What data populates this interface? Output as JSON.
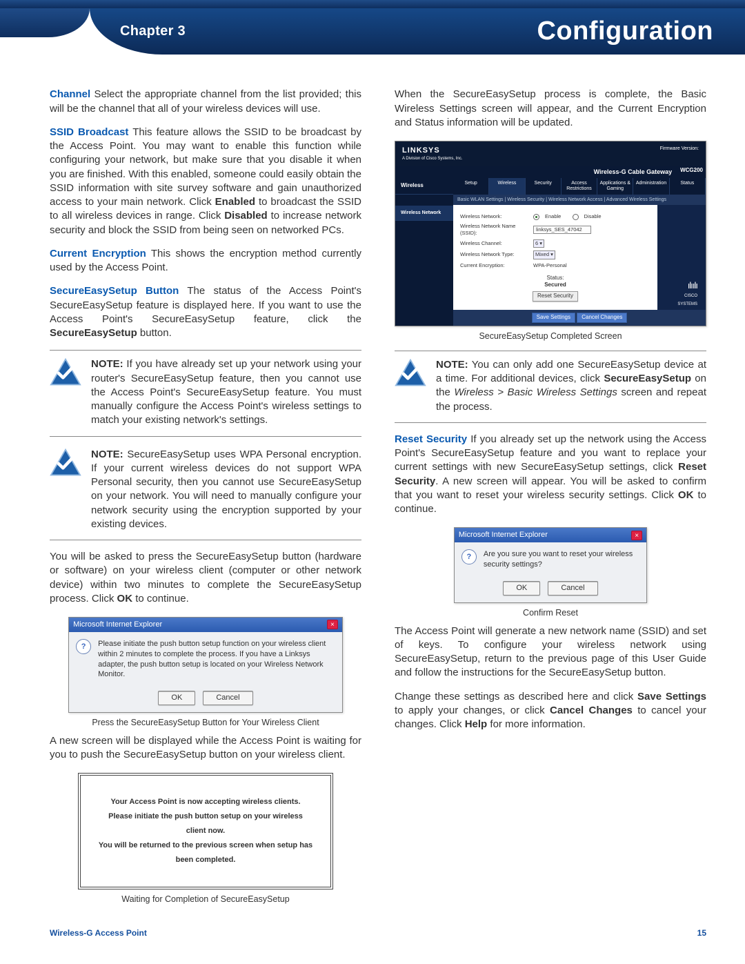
{
  "header": {
    "chapter": "Chapter 3",
    "title": "Configuration"
  },
  "left": {
    "p_channel": {
      "term": "Channel",
      "text": "  Select the appropriate channel from the list provided; this will be the channel that all of your wireless devices will use."
    },
    "p_ssid": {
      "term": "SSID Broadcast",
      "t1": " This feature allows the SSID to be broadcast by the Access Point. You may want to enable this function while configuring your network, but make sure that you disable it when you are finished. With this enabled, someone could easily obtain the SSID information with site survey software and gain unauthorized access to your main network. Click ",
      "b1": "Enabled",
      "t2": " to broadcast the SSID to all wireless devices in range. Click ",
      "b2": "Disabled",
      "t3": " to increase network security and block the SSID from being seen on networked PCs."
    },
    "p_enc": {
      "term": "Current Encryption",
      "text": "  This shows the encryption method currently used by the Access Point."
    },
    "p_ses": {
      "term": "SecureEasySetup Button",
      "t1": "   The status of the Access Point's SecureEasySetup feature is displayed here. If you want to use the Access Point's SecureEasySetup feature, click the ",
      "b1": "SecureEasySetup",
      "t2": " button."
    },
    "note1": {
      "label": "NOTE:",
      "text": " If you have already set up your network using your router's SecureEasySetup feature, then you cannot use the Access Point's SecureEasySetup feature. You must manually configure the Access Point's wireless settings to match your existing network's settings."
    },
    "note2": {
      "label": "NOTE:",
      "text": " SecureEasySetup uses WPA Personal encryption. If your current wireless devices do not support WPA Personal security, then you cannot use SecureEasySetup on your network. You will need to manually configure your network security using the encryption supported by your existing devices."
    },
    "p_press": {
      "t1": "You will be asked to press the SecureEasySetup button (hardware or software) on your wireless client (computer or other network device) within two minutes to complete the SecureEasySetup process. Click ",
      "b1": "OK",
      "t2": " to continue."
    },
    "dlg1": {
      "title": "Microsoft Internet Explorer",
      "msg": "Please initiate the push button setup function on your wireless client within 2 minutes to complete the process.  If you have a Linksys adapter, the push button setup is located on your Wireless Network Monitor.",
      "ok": "OK",
      "cancel": "Cancel",
      "caption": "Press the SecureEasySetup Button for Your Wireless Client"
    },
    "p_wait": "A new screen will be displayed while the Access Point is waiting for you to push the SecureEasySetup button on your wireless client.",
    "wait": {
      "l1": "Your Access Point is now accepting wireless clients.",
      "l2": "Please initiate the push button setup on your wireless client now.",
      "l3": "You will be returned to the previous screen when setup has been completed.",
      "caption": "Waiting for Completion of SecureEasySetup"
    }
  },
  "right": {
    "p_complete": "When the SecureEasySetup process is complete, the Basic Wireless Settings screen will appear, and the Current Encryption and Status information will be updated.",
    "linksys": {
      "logo": "LINKSYS",
      "sub": "A Division of Cisco Systems, Inc.",
      "fw": "Firmware Version: ",
      "bar_title": "Wireless-G Cable Gateway",
      "model": "WCG200",
      "side": "Wireless",
      "side_sub": "Wireless Network",
      "tabs": [
        "Setup",
        "Wireless",
        "Security",
        "Access Restrictions",
        "Applications & Gaming",
        "Administration",
        "Status"
      ],
      "subtabs": "Basic WLAN Settings   |   Wireless Security   |   Wireless Network Access   |   Advanced Wireless Settings",
      "rows": {
        "wn": "Wireless Network:",
        "enable": "Enable",
        "disable": "Disable",
        "ssid": "Wireless Network Name (SSID):",
        "ssid_v": "linksys_SES_47042",
        "chan": "Wireless Channel:",
        "chan_v": "6",
        "type": "Wireless Network Type:",
        "type_v": "Mixed",
        "enc": "Current Encryption:",
        "enc_v": "WPA-Personal",
        "status": "Status:",
        "status_v": "Secured",
        "reset": "Reset Security"
      },
      "save": "Save Settings",
      "cancel": "Cancel Changes",
      "cisco": "CISCO SYSTEMS",
      "caption": "SecureEasySetup Completed Screen"
    },
    "note3": {
      "label": "NOTE:",
      "t1": " You can only add one SecureEasySetup device at a time. For additional devices, click ",
      "b1": "SecureEasySetup",
      "t2": " on the ",
      "i1": "Wireless > Basic Wireless Settings",
      "t3": " screen and repeat the process."
    },
    "p_reset": {
      "term": "Reset Security",
      "t1": "  If you already set up the network using the Access Point's SecureEasySetup feature and you want to replace your current settings with new SecureEasySetup settings, click ",
      "b1": "Reset Security",
      "t2": ". A new screen will appear. You will be asked to confirm that you want to reset your wireless security settings. Click ",
      "b2": "OK",
      "t3": " to continue."
    },
    "dlg2": {
      "title": "Microsoft Internet Explorer",
      "msg": "Are you sure you want to reset your wireless security settings?",
      "ok": "OK",
      "cancel": "Cancel",
      "caption": "Confirm Reset"
    },
    "p_gen": "The Access Point will generate a new network name (SSID) and set of keys. To configure your wireless network using SecureEasySetup, return to the previous page of this User Guide and follow the instructions for the SecureEasySetup button.",
    "p_save": {
      "t1": "Change these settings as described here and click ",
      "b1": "Save Settings",
      "t2": " to apply your changes, or click ",
      "b2": "Cancel Changes",
      "t3": " to cancel your changes. Click ",
      "b3": "Help",
      "t4": " for more information."
    }
  },
  "footer": {
    "product": "Wireless-G Access Point",
    "page": "15"
  }
}
